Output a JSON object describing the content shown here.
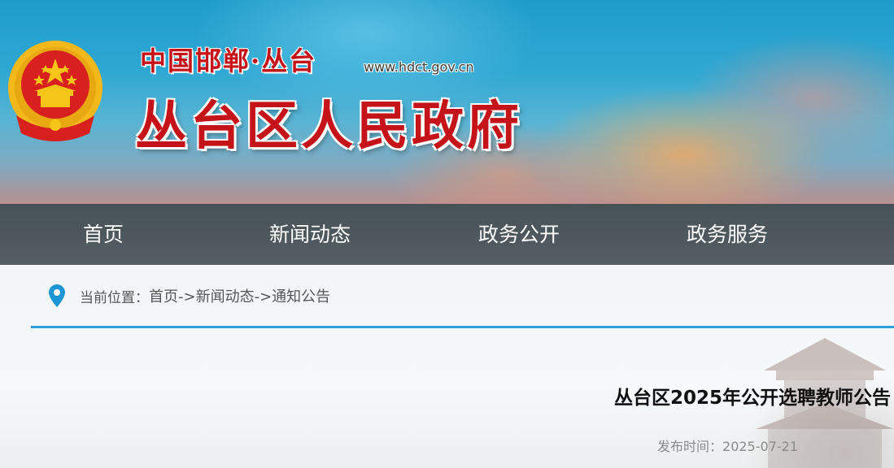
{
  "header": {
    "subtitle": "中国邯郸·丛台",
    "url": "www.hdct.gov.cn",
    "title": "丛台区人民政府",
    "emblem_icon": "national-emblem-icon"
  },
  "nav": {
    "items": [
      {
        "label": "首页"
      },
      {
        "label": "新闻动态"
      },
      {
        "label": "政务公开"
      },
      {
        "label": "政务服务"
      }
    ]
  },
  "breadcrumb": {
    "icon": "location-pin-icon",
    "label": "当前位置：",
    "home": "首页",
    "sep1": "->",
    "section": "新闻动态",
    "sep2": "->",
    "current": "通知公告"
  },
  "article": {
    "title": "丛台区2025年公开选聘教师公告",
    "publish_label": "发布时间：",
    "publish_date": "2025-07-21"
  },
  "colors": {
    "brand_red": "#c4141a",
    "accent_blue": "#2a9fd9",
    "nav_bg": "#3c484e"
  }
}
